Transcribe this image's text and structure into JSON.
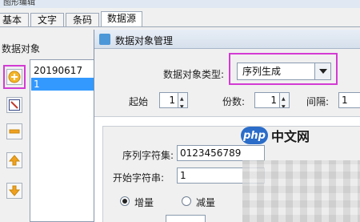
{
  "window": {
    "title": "图形编辑"
  },
  "tabs": [
    {
      "label": "基本"
    },
    {
      "label": "文字"
    },
    {
      "label": "条码"
    },
    {
      "label": "数据源",
      "active": true
    }
  ],
  "datasource": {
    "label": "数据对象",
    "items": [
      {
        "label": "20190617",
        "selected": false
      },
      {
        "label": "1",
        "selected": true
      }
    ],
    "tools": [
      {
        "icon": "add-icon"
      },
      {
        "icon": "edit-icon"
      },
      {
        "icon": "remove-icon"
      },
      {
        "icon": "move-up-icon"
      },
      {
        "icon": "move-down-icon"
      }
    ]
  },
  "dialog": {
    "title": "数据对象管理",
    "type_label": "数据对象类型:",
    "type_value": "序列生成",
    "start_label": "起始",
    "start_value": "1",
    "copies_label": "份数:",
    "copies_value": "1",
    "interval_label": "间隔:",
    "interval_value": "1",
    "charset_label": "序列字符集:",
    "charset_value": "0123456789",
    "start_str_label": "开始字符串:",
    "start_str_value": "1",
    "increase_label": "增量",
    "decrease_label": "减量",
    "direction": "increase"
  },
  "watermark": {
    "badge": "php",
    "text": "中文网"
  },
  "colors": {
    "highlight": "#d43bd4",
    "selection": "#3399ff",
    "arrow_icon": "#f0a020"
  }
}
